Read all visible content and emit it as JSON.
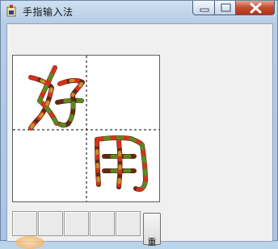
{
  "window": {
    "title": "手指输入法",
    "app_icon": "ink-bottle-icon",
    "controls": {
      "minimize": "minimize-icon",
      "maximize": "maximize-icon",
      "close": "close-icon"
    }
  },
  "pad": {
    "written_characters": [
      "好",
      "用"
    ],
    "stroke_colors": [
      "#5e2a12",
      "#d6311c",
      "#5a8a1f",
      "#c8902a"
    ]
  },
  "candidates": {
    "slots": [
      "",
      "",
      "",
      "",
      ""
    ]
  },
  "side_button": {
    "label": "重"
  },
  "colors": {
    "titlebar": "#bcd4ea",
    "close": "#c54a2f"
  }
}
